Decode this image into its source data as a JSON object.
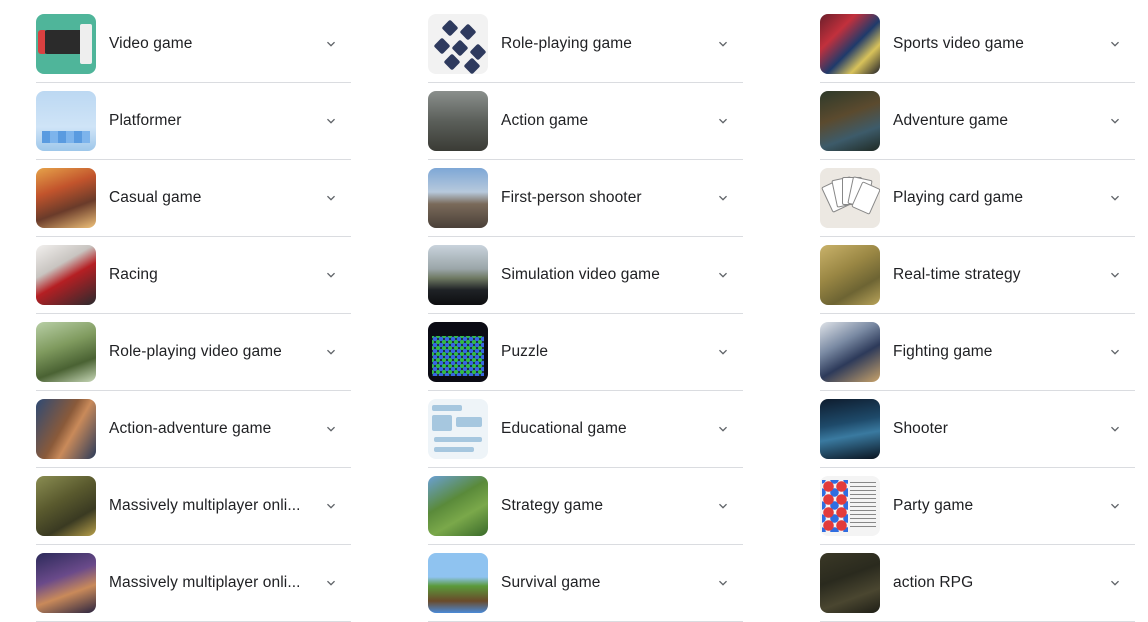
{
  "columns": [
    {
      "items": [
        {
          "label": "Video game",
          "icon": "video-game-thumbnail"
        },
        {
          "label": "Platformer",
          "icon": "platformer-thumbnail"
        },
        {
          "label": "Casual game",
          "icon": "casual-game-thumbnail"
        },
        {
          "label": "Racing",
          "icon": "racing-thumbnail"
        },
        {
          "label": "Role-playing video game",
          "icon": "role-playing-video-game-thumbnail"
        },
        {
          "label": "Action-adventure game",
          "icon": "action-adventure-game-thumbnail"
        },
        {
          "label": "Massively multiplayer onli...",
          "icon": "mmo-thumbnail"
        },
        {
          "label": "Massively multiplayer onli...",
          "icon": "mmo-thumbnail-2"
        }
      ]
    },
    {
      "items": [
        {
          "label": "Role-playing game",
          "icon": "role-playing-game-thumbnail"
        },
        {
          "label": "Action game",
          "icon": "action-game-thumbnail"
        },
        {
          "label": "First-person shooter",
          "icon": "first-person-shooter-thumbnail"
        },
        {
          "label": "Simulation video game",
          "icon": "simulation-video-game-thumbnail"
        },
        {
          "label": "Puzzle",
          "icon": "puzzle-thumbnail"
        },
        {
          "label": "Educational game",
          "icon": "educational-game-thumbnail"
        },
        {
          "label": "Strategy game",
          "icon": "strategy-game-thumbnail"
        },
        {
          "label": "Survival game",
          "icon": "survival-game-thumbnail"
        }
      ]
    },
    {
      "items": [
        {
          "label": "Sports video game",
          "icon": "sports-video-game-thumbnail"
        },
        {
          "label": "Adventure game",
          "icon": "adventure-game-thumbnail"
        },
        {
          "label": "Playing card game",
          "icon": "playing-card-game-thumbnail"
        },
        {
          "label": "Real-time strategy",
          "icon": "real-time-strategy-thumbnail"
        },
        {
          "label": "Fighting game",
          "icon": "fighting-game-thumbnail"
        },
        {
          "label": "Shooter",
          "icon": "shooter-thumbnail"
        },
        {
          "label": "Party game",
          "icon": "party-game-thumbnail"
        },
        {
          "label": "action RPG",
          "icon": "action-rpg-thumbnail"
        }
      ]
    }
  ],
  "chevron_icon": "chevron-down-icon",
  "colors": {
    "text": "#202124",
    "divider": "#dadce0",
    "chevron": "#5f6368"
  }
}
